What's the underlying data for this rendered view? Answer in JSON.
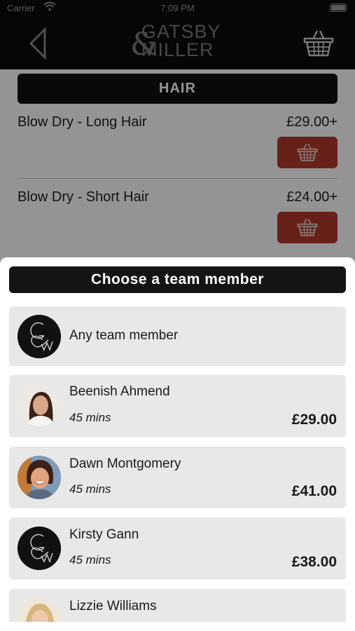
{
  "status_bar": {
    "carrier": "Carrier",
    "time": "7:09 PM"
  },
  "nav": {
    "logo_line1": "GATSBY",
    "logo_line2": "MILLER",
    "back_icon": "chevron-left-icon",
    "basket_icon": "basket-icon"
  },
  "section": {
    "title": "HAIR"
  },
  "services": [
    {
      "name": "Blow Dry - Long Hair",
      "price": "£29.00+"
    },
    {
      "name": "Blow Dry - Short Hair",
      "price": "£24.00+"
    }
  ],
  "sheet": {
    "title": "Choose a team member",
    "members": [
      {
        "name": "Any team member",
        "avatar": "logo-avatar"
      },
      {
        "name": "Beenish Ahmend",
        "duration": "45 mins",
        "price": "£29.00",
        "avatar": "photo-avatar"
      },
      {
        "name": "Dawn Montgomery",
        "duration": "45 mins",
        "price": "£41.00",
        "avatar": "photo-avatar"
      },
      {
        "name": "Kirsty Gann",
        "duration": "45 mins",
        "price": "£38.00",
        "avatar": "logo-avatar"
      },
      {
        "name": "Lizzie Williams",
        "avatar": "photo-avatar"
      }
    ]
  },
  "colors": {
    "nav_background": "#0b0b0b",
    "accent_red": "#b23a2c",
    "card_background": "#e8e8e8"
  }
}
